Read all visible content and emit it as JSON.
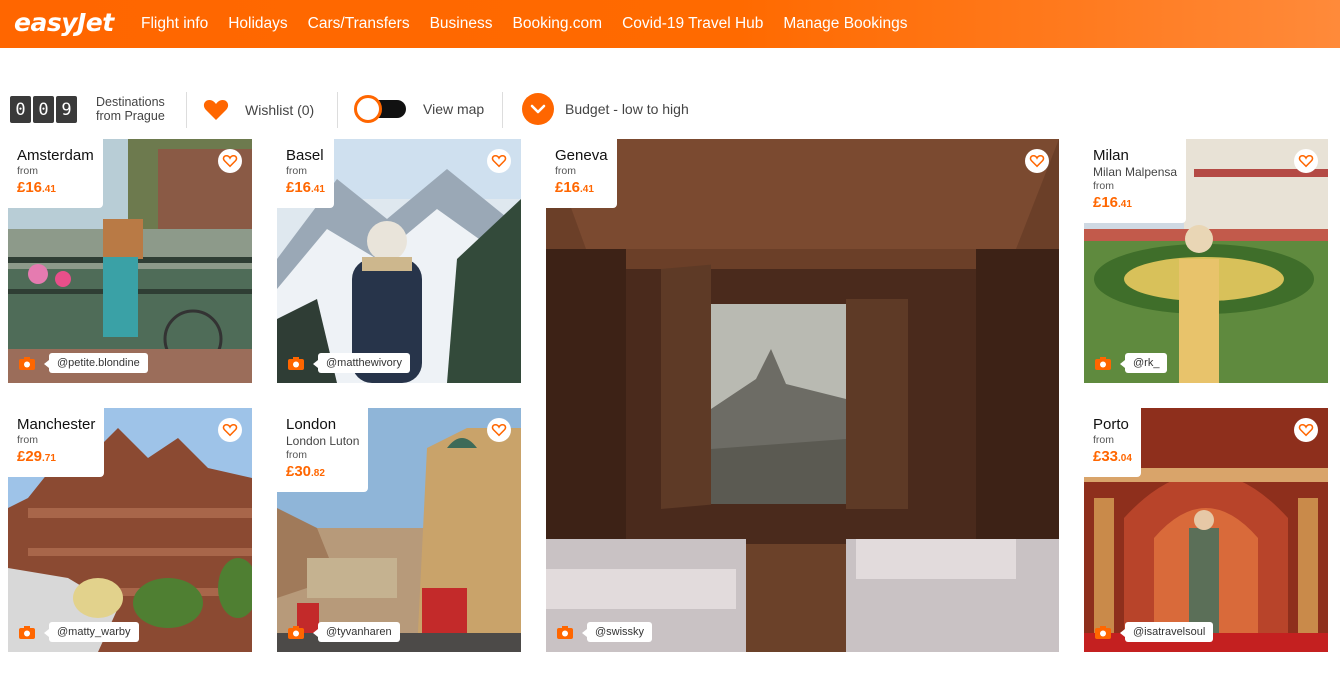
{
  "brand": {
    "logo_text": "easyJet",
    "accent": "#ff6600"
  },
  "nav": {
    "links": [
      "Flight info",
      "Holidays",
      "Cars/Transfers",
      "Business",
      "Booking.com",
      "Covid-19 Travel Hub",
      "Manage Bookings"
    ]
  },
  "toolbar": {
    "count_digits": [
      "0",
      "0",
      "9"
    ],
    "count_label_line1": "Destinations",
    "count_label_line2": "from Prague",
    "wishlist_label": "Wishlist (0)",
    "map_label": "View map",
    "sort_label": "Budget - low to high"
  },
  "destinations": [
    {
      "city": "Amsterdam",
      "airport": "",
      "from": "from",
      "price_main": "£16",
      "price_pence": ".41",
      "credit": "@petite.blondine"
    },
    {
      "city": "Basel",
      "airport": "",
      "from": "from",
      "price_main": "£16",
      "price_pence": ".41",
      "credit": "@matthewivory"
    },
    {
      "city": "Geneva",
      "airport": "",
      "from": "from",
      "price_main": "£16",
      "price_pence": ".41",
      "credit": "@swissky"
    },
    {
      "city": "Milan",
      "airport": "Milan Malpensa",
      "from": "from",
      "price_main": "£16",
      "price_pence": ".41",
      "credit": "@rk_"
    },
    {
      "city": "Manchester",
      "airport": "",
      "from": "from",
      "price_main": "£29",
      "price_pence": ".71",
      "credit": "@matty_warby"
    },
    {
      "city": "London",
      "airport": "London Luton",
      "from": "from",
      "price_main": "£30",
      "price_pence": ".82",
      "credit": "@tyvanharen"
    },
    {
      "city": "Porto",
      "airport": "",
      "from": "from",
      "price_main": "£33",
      "price_pence": ".04",
      "credit": "@isatravelsoul"
    }
  ]
}
